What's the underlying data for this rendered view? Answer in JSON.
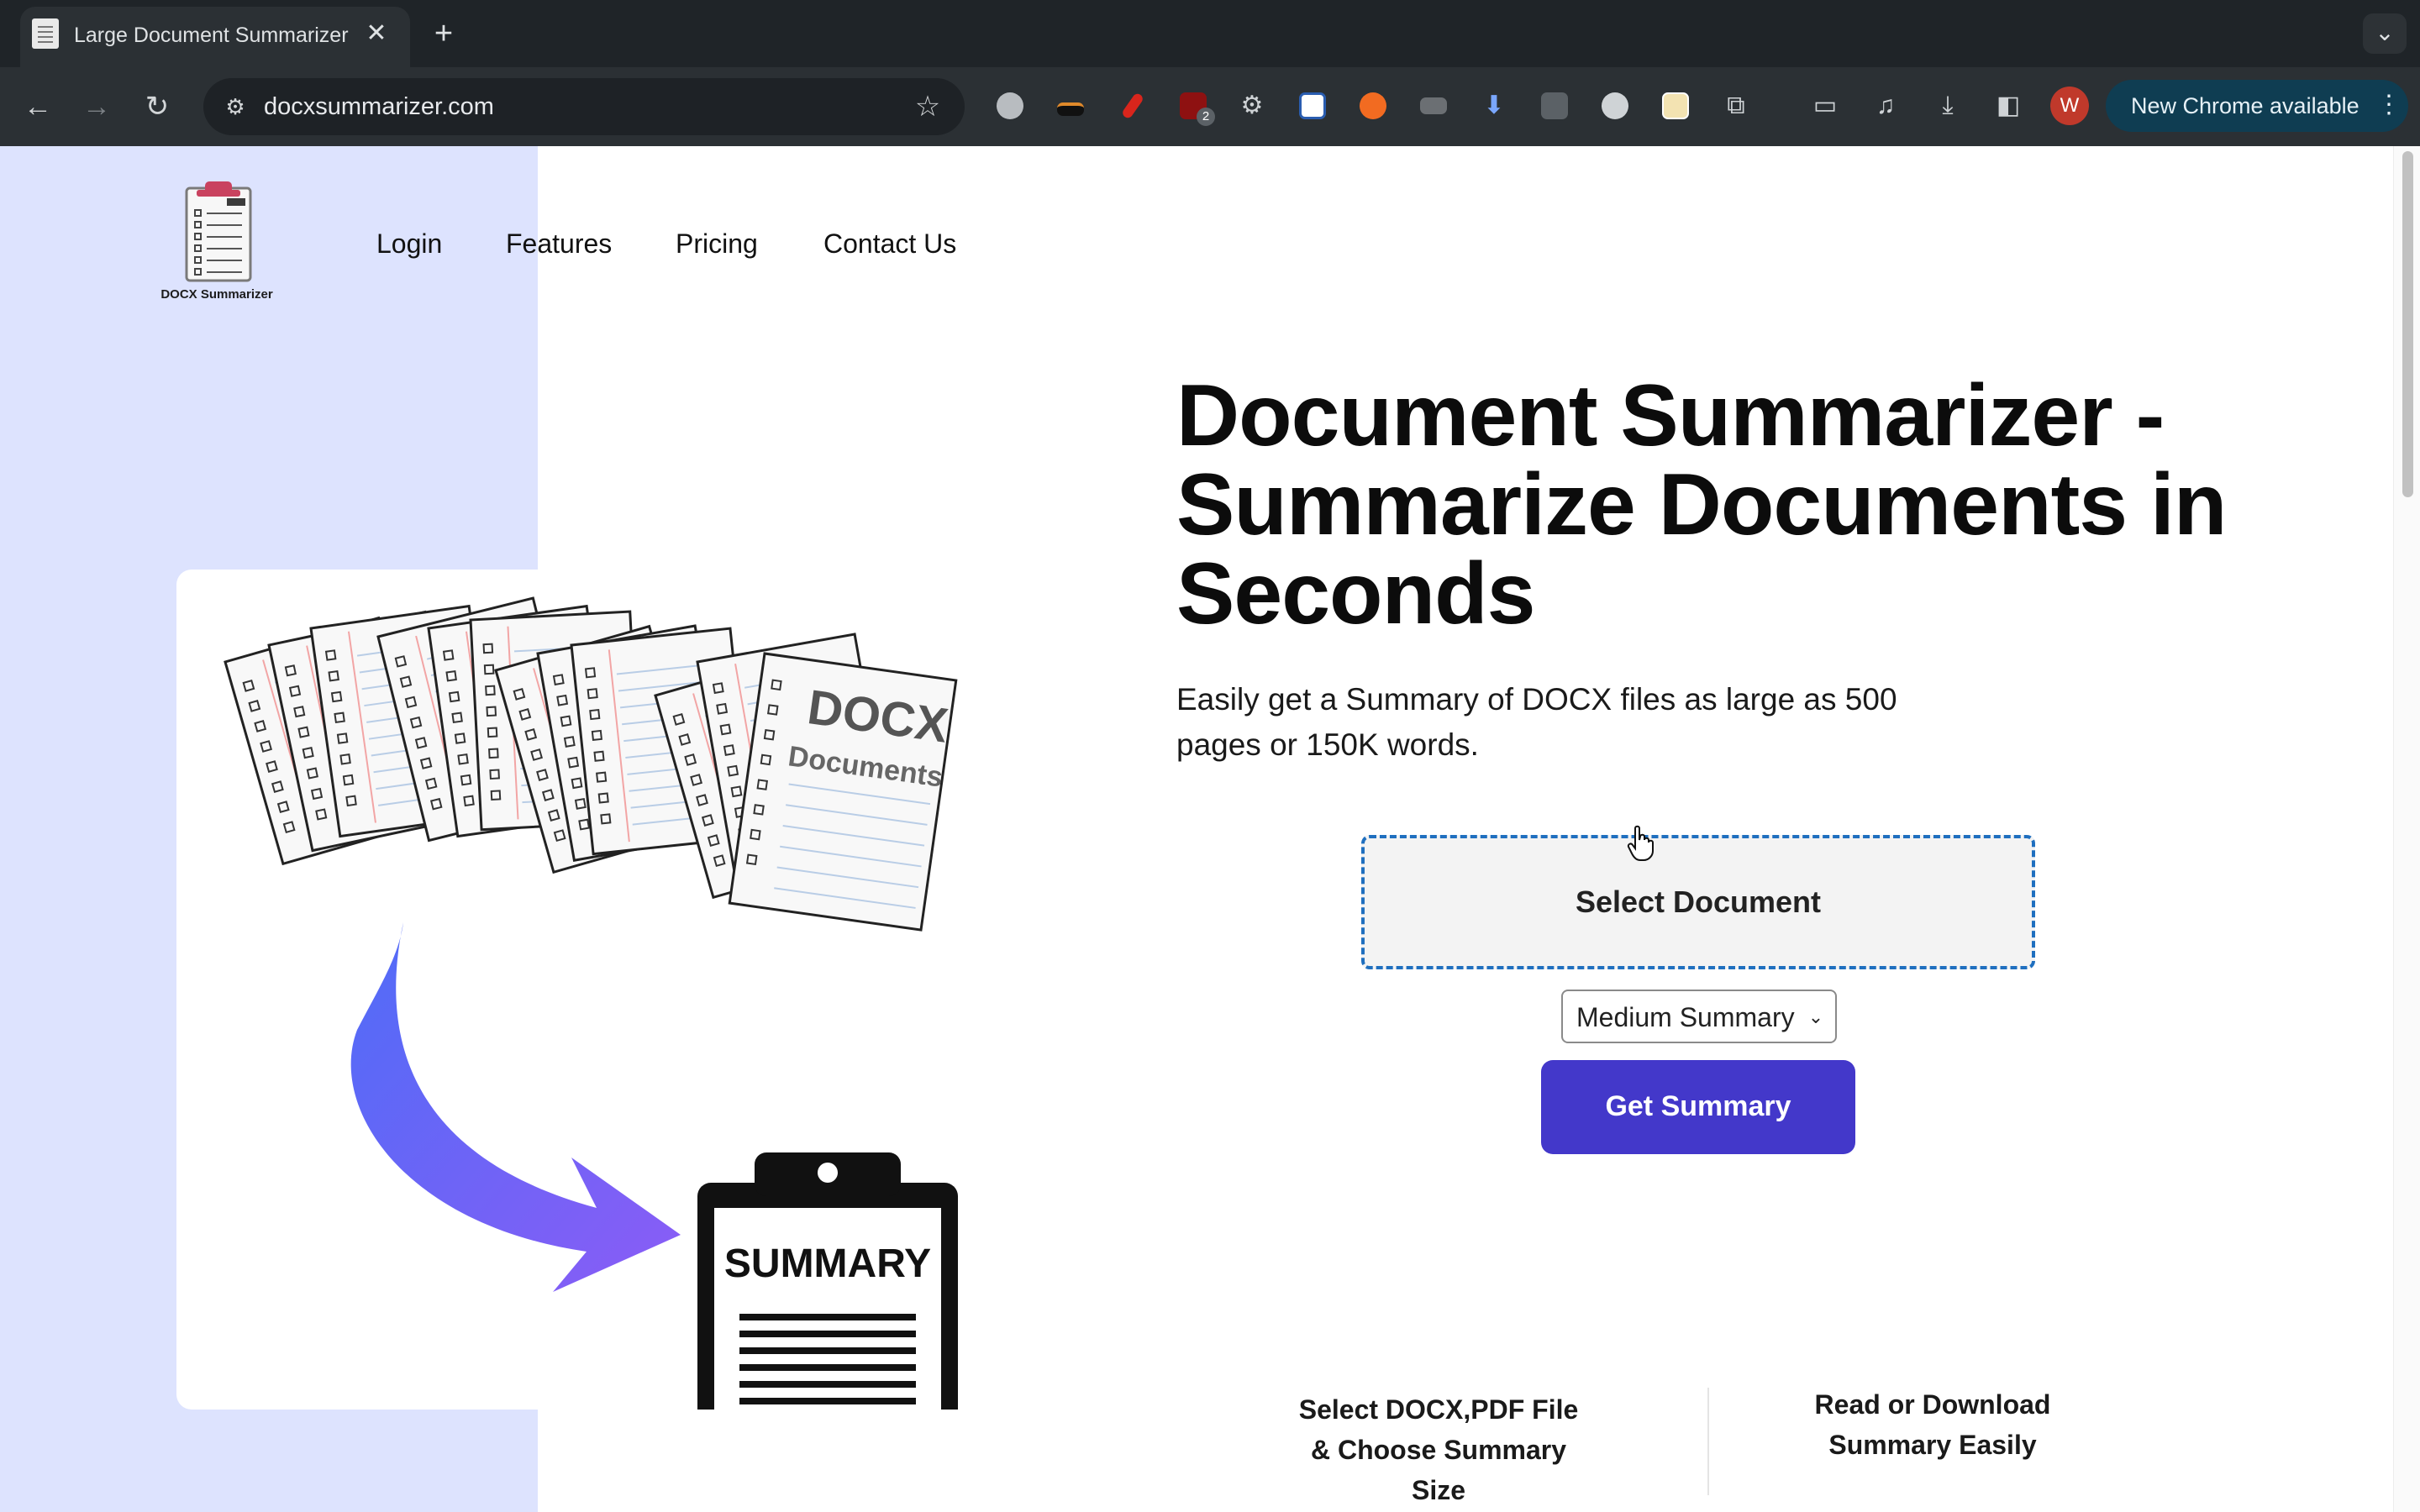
{
  "browser": {
    "tab_title": "Large Document Summarizer",
    "url": "docxsummarizer.com",
    "profile_initial": "W",
    "update_label": "New Chrome available",
    "extension_badge": "2"
  },
  "site": {
    "logo_caption": "DOCX Summarizer",
    "nav": [
      "Login",
      "Features",
      "Pricing",
      "Contact Us"
    ]
  },
  "hero": {
    "title": "Document Summarizer - Summarize Documents in Seconds",
    "subtitle": "Easily get a Summary of DOCX files as large as 500 pages or 150K words.",
    "select_button": "Select Document",
    "summary_size": {
      "selected": "Medium Summary"
    },
    "submit_button": "Get Summary",
    "illustration": {
      "docs_label_1": "DOCX",
      "docs_label_2": "Documents",
      "clipboard_label": "SUMMARY"
    }
  },
  "steps": [
    "Select DOCX,PDF File & Choose Summary Size",
    "Read or Download Summary Easily"
  ],
  "colors": {
    "left_panel": "#dde3fe",
    "primary_button": "#4338ca",
    "dashed_border": "#1f6fbf",
    "arrow_start": "#4f6cf7",
    "arrow_end": "#8b5cf6"
  }
}
